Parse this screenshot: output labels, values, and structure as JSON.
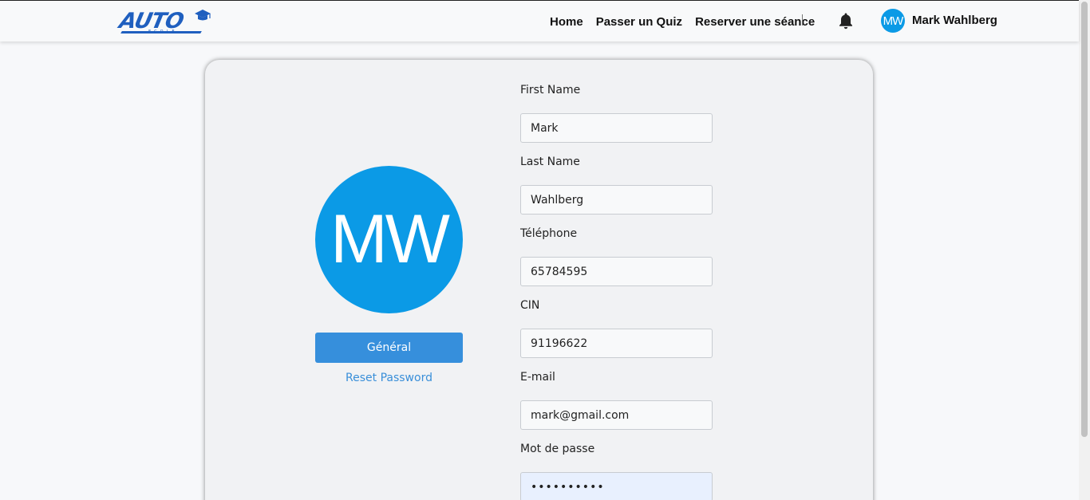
{
  "brand": {
    "logo_text": "AUTO",
    "logo_sub": "ECOLE",
    "logo_color": "#1f5fbf"
  },
  "nav": {
    "links": [
      "Home",
      "Passer un Quiz",
      "Reserver une séance"
    ],
    "bell_icon": "bell-icon"
  },
  "user": {
    "initials": "MW",
    "name": "Mark Wahlberg",
    "avatar_color": "#0b9ae6"
  },
  "profile": {
    "initials": "MW",
    "general_button": "Général",
    "reset_link": "Reset Password",
    "button_color": "#368fdc",
    "fields": [
      {
        "label": "First Name",
        "value": "Mark"
      },
      {
        "label": "Last Name",
        "value": "Wahlberg"
      },
      {
        "label": "Téléphone",
        "value": "65784595"
      },
      {
        "label": "CIN",
        "value": "91196622"
      },
      {
        "label": "E-mail",
        "value": "mark@gmail.com"
      },
      {
        "label": "Mot de passe",
        "value": "••••••••••"
      }
    ]
  }
}
